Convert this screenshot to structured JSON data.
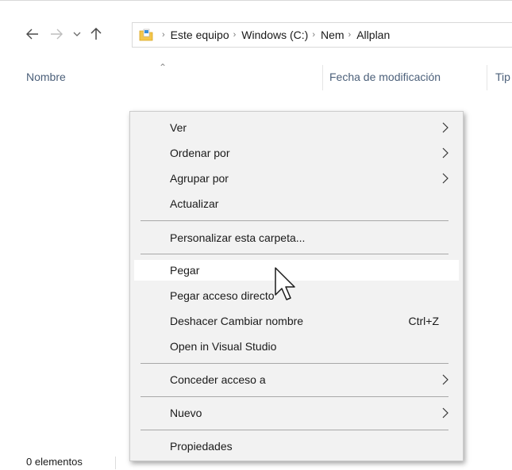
{
  "nav": {
    "back_icon": "arrow-left-icon",
    "forward_icon": "arrow-right-icon",
    "recent_icon": "chevron-down-icon",
    "up_icon": "arrow-up-icon"
  },
  "address": {
    "crumbs": [
      "Este equipo",
      "Windows (C:)",
      "Nem",
      "Allplan"
    ]
  },
  "columns": {
    "name": "Nombre",
    "date": "Fecha de modificación",
    "type": "Tip"
  },
  "status": {
    "text": "0 elementos"
  },
  "context_menu": {
    "items": [
      {
        "label": "Ver",
        "submenu": true
      },
      {
        "label": "Ordenar por",
        "submenu": true
      },
      {
        "label": "Agrupar por",
        "submenu": true
      },
      {
        "label": "Actualizar",
        "submenu": false
      },
      {
        "label": "Personalizar esta carpeta...",
        "submenu": false
      },
      {
        "label": "Pegar",
        "submenu": false,
        "hover": true
      },
      {
        "label": "Pegar acceso directo",
        "submenu": false
      },
      {
        "label": "Deshacer Cambiar nombre",
        "submenu": false,
        "shortcut": "Ctrl+Z"
      },
      {
        "label": "Open in Visual Studio",
        "submenu": false
      },
      {
        "label": "Conceder acceso a",
        "submenu": true
      },
      {
        "label": "Nuevo",
        "submenu": true
      },
      {
        "label": "Propiedades",
        "submenu": false
      }
    ]
  },
  "colors": {
    "menu_bg": "#f2f2f2",
    "hover_bg": "#ffffff",
    "header_text": "#4c607a",
    "folder_yellow": "#f4c64b"
  }
}
